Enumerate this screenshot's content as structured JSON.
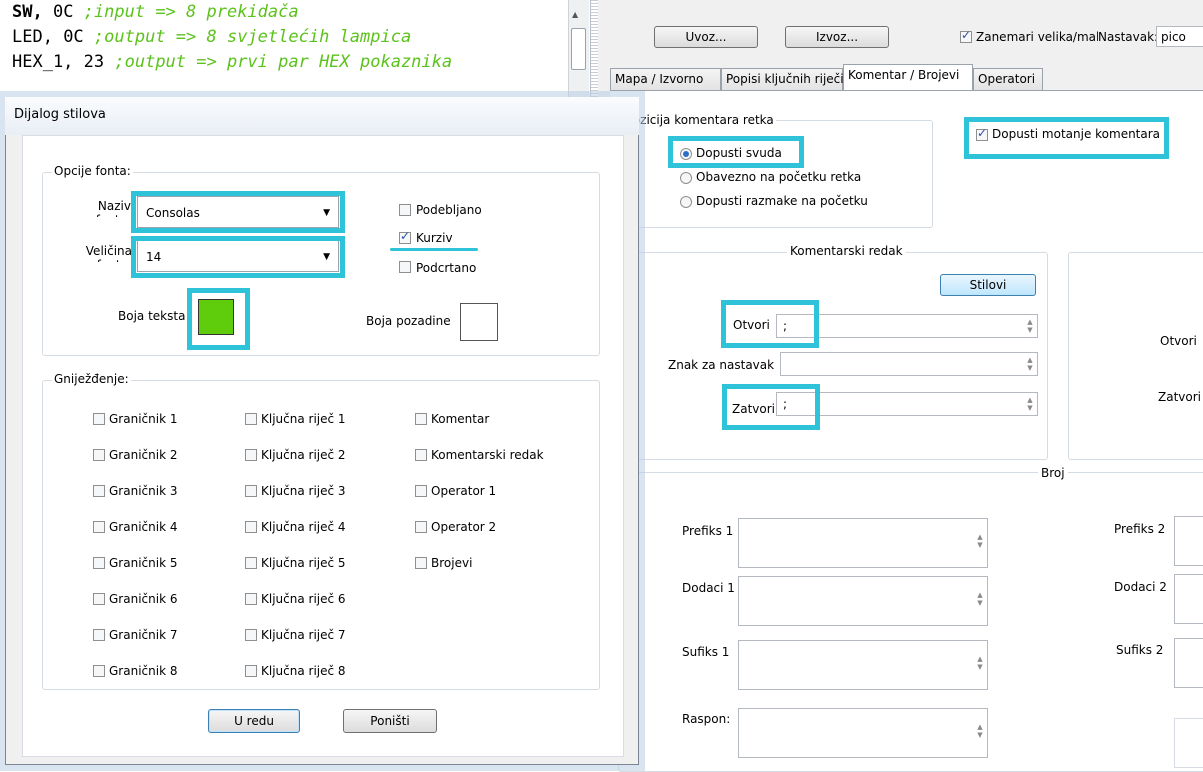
{
  "editor": {
    "lines": [
      {
        "name": "SW,",
        "value": " 0C ",
        "comment": ";input => 8 prekidača"
      },
      {
        "name": "LED,",
        "value": " 0C ",
        "comment": ";output => 8 svjetlećih lampica"
      },
      {
        "name": "HEX_1,",
        "value": " 23 ",
        "comment": ";output => prvi par HEX pokaznika"
      }
    ]
  },
  "settings": {
    "import_label": "Uvoz...",
    "export_label": "Izvoz...",
    "ignore_case_label": "Zanemari velika/mal",
    "extension_label": "Nastavak:",
    "extension_value": "pico",
    "tabs": [
      "Mapa / Izvorno",
      "Popisi ključnih riječi",
      "Komentar / Brojevi",
      "Operatori"
    ],
    "line_comment_position": {
      "title": "Pozicija komentara retka",
      "options": [
        "Dopusti svuda",
        "Obavezno na početku retka",
        "Dopusti razmake na početku"
      ]
    },
    "allow_wrap_label": "Dopusti motanje komentara",
    "comment_line": {
      "title": "Komentarski redak",
      "styles_button": "Stilovi",
      "open_label": "Otvori",
      "open_value": ";",
      "continue_label": "Znak za nastavak",
      "continue_value": "",
      "close_label": "Zatvori",
      "close_value": ";"
    },
    "right_group": {
      "open_label": "Otvori",
      "close_label": "Zatvori"
    },
    "number": {
      "title": "Broj",
      "prefix1": "Prefiks 1",
      "suffix_extras1": "Dodaci 1",
      "suffix1": "Sufiks 1",
      "range": "Raspon:",
      "prefix2": "Prefiks 2",
      "extras2": "Dodaci 2",
      "suffix2": "Sufiks 2"
    }
  },
  "dialog": {
    "title": "Dijalog stilova",
    "font_group": "Opcije fonta:",
    "font_name_label": "Naziv fonta:",
    "font_name_value": "Consolas",
    "font_size_label": "Veličina fonta:",
    "font_size_value": "14",
    "bold_label": "Podebljano",
    "italic_label": "Kurziv",
    "underline_label": "Podcrtano",
    "text_color_label": "Boja teksta",
    "bg_color_label": "Boja pozadine",
    "nesting_group": "Gniježđenje:",
    "col1": [
      "Graničnik 1",
      "Graničnik 2",
      "Graničnik 3",
      "Graničnik 4",
      "Graničnik 5",
      "Graničnik 6",
      "Graničnik 7",
      "Graničnik 8"
    ],
    "col2": [
      "Ključna riječ 1",
      "Ključna riječ 2",
      "Ključna riječ 3",
      "Ključna riječ 4",
      "Ključna riječ 5",
      "Ključna riječ 6",
      "Ključna riječ 7",
      "Ključna riječ 8"
    ],
    "col3": [
      "Komentar",
      "Komentarski redak",
      "Operator 1",
      "Operator 2",
      "Brojevi"
    ],
    "ok_label": "U redu",
    "cancel_label": "Poništi"
  },
  "colors": {
    "text_color": "#5fcc0c",
    "bg_color": "#ffffff",
    "highlight": "#2ec3d8",
    "comment": "#5cc21c"
  }
}
